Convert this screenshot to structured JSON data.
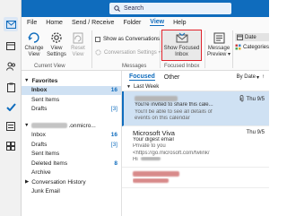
{
  "app": {
    "search_label": "Search",
    "accent_color": "#0f6cbd",
    "highlight_color": "#e1212a"
  },
  "menu": [
    {
      "label": "File"
    },
    {
      "label": "Home"
    },
    {
      "label": "Send / Receive"
    },
    {
      "label": "Folder"
    },
    {
      "label": "View",
      "active": true
    },
    {
      "label": "Help"
    }
  ],
  "ribbon": {
    "change_view": "Change View",
    "view_settings": "View Settings",
    "reset_view": "Reset View",
    "current_view_group": "Current View",
    "show_as_conversations": "Show as Conversations",
    "conversation_settings": "Conversation Settings",
    "messages_group": "Messages",
    "show_focused_inbox": "Show Focused Inbox",
    "focused_inbox_group": "Focused Inbox",
    "message_preview": "Message Preview",
    "date": "Date",
    "categories": "Categories"
  },
  "folders": {
    "favorites_label": "Favorites",
    "favorites": [
      {
        "name": "Inbox",
        "count": "16",
        "selected": true
      },
      {
        "name": "Sent Items",
        "count": ""
      },
      {
        "name": "Drafts",
        "count": "[3]"
      }
    ],
    "account_suffix": ".onmicro...",
    "account_folders": [
      {
        "name": "Inbox",
        "count": "16"
      },
      {
        "name": "Drafts",
        "count": "[3]"
      },
      {
        "name": "Sent Items",
        "count": ""
      },
      {
        "name": "Deleted Items",
        "count": "8"
      },
      {
        "name": "Archive",
        "count": ""
      },
      {
        "name": "Conversation History",
        "count": "",
        "collapsible": true
      },
      {
        "name": "Junk Email",
        "count": ""
      }
    ]
  },
  "message_list": {
    "tab_focused": "Focused",
    "tab_other": "Other",
    "sort_label": "By Date",
    "group_label": "Last Week",
    "messages": [
      {
        "subject": "You're invited to share this cale...",
        "preview": "You'll be able to see all details of",
        "preview2": "events on this calendar",
        "date": "Thu 9/5",
        "selected": true
      },
      {
        "from": "Microsoft Viva",
        "subject": "Your digest email",
        "preview": "Private to you",
        "preview2": "<https://go.microsoft.com/fwlink/",
        "preview3": "Hi",
        "date": "Thu 9/5"
      },
      {
        "subject": "Re: Invoice at work",
        "preview": "",
        "date": ""
      }
    ]
  }
}
